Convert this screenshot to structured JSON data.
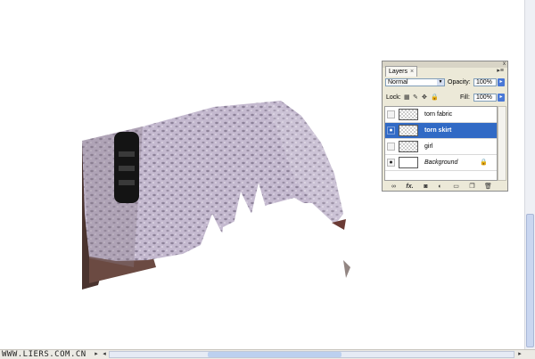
{
  "watermark": "WWW.LIERS.COM.CN",
  "panel": {
    "tab_label": "Layers",
    "tab_close": "×",
    "menu_glyph": "▸≡",
    "blend_mode": "Normal",
    "opacity_label": "Opacity:",
    "opacity_value": "100%",
    "lock_label": "Lock:",
    "fill_label": "Fill:",
    "fill_value": "100%",
    "close_glyph": "x",
    "layers": [
      {
        "name": "torn fabric",
        "visible": false,
        "selected": false
      },
      {
        "name": "torn skirt",
        "visible": true,
        "selected": true
      },
      {
        "name": "girl",
        "visible": false,
        "selected": false
      },
      {
        "name": "Background",
        "visible": true,
        "selected": false,
        "locked": true
      }
    ],
    "bottom_icons": [
      "link-icon",
      "fx-icon",
      "mask-icon",
      "adjustment-icon",
      "folder-icon",
      "new-layer-icon",
      "trash-icon"
    ],
    "fx_text": "fx."
  },
  "colors": {
    "selection": "#316ac5",
    "skirt": "#b8adc4",
    "skin": "#5a3c35"
  }
}
